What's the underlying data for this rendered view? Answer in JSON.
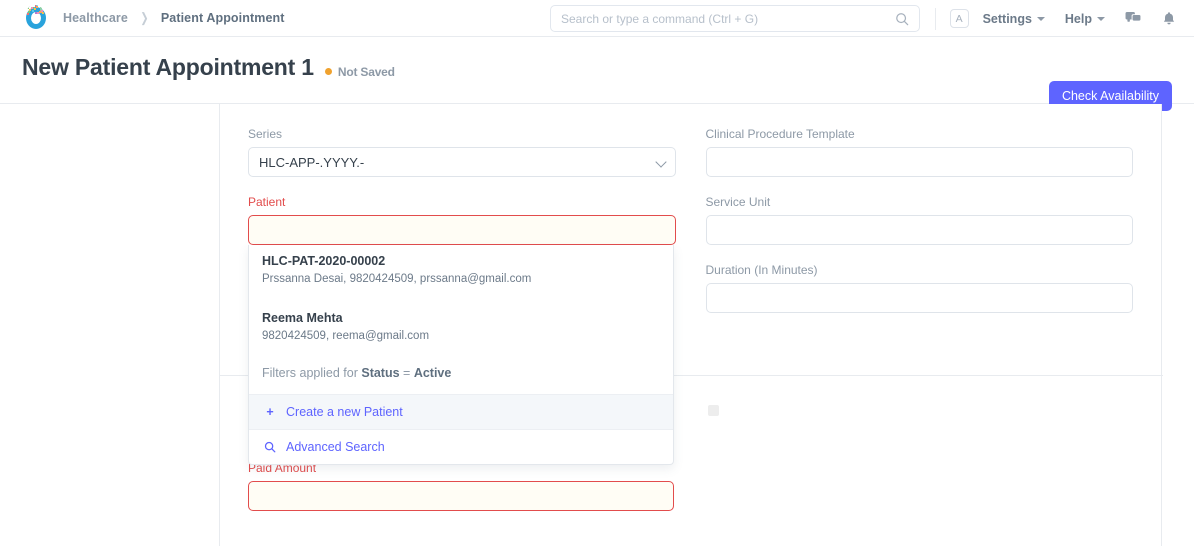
{
  "navbar": {
    "logo_icon": "frappe-ring-logo",
    "breadcrumbs": [
      {
        "label": "Healthcare"
      },
      {
        "label": "Patient Appointment"
      }
    ],
    "search": {
      "placeholder": "Search or type a command (Ctrl + G)",
      "value": "",
      "icon": "search-icon"
    },
    "avatar_initial": "A",
    "links": [
      {
        "label": "Settings"
      },
      {
        "label": "Help"
      }
    ],
    "icons": [
      {
        "name": "comments-icon"
      },
      {
        "name": "notifications-bell-icon"
      }
    ]
  },
  "page": {
    "title": "New Patient Appointment 1",
    "status": "Not Saved",
    "status_color": "#f0a22e",
    "primary_button": "Check Availability",
    "primary_button_color": "#5e64ff"
  },
  "form": {
    "fields": {
      "series": {
        "label": "Series",
        "value": "HLC-APP-.YYYY.-",
        "placeholder": ""
      },
      "patient": {
        "label": "Patient",
        "value": "",
        "placeholder": "",
        "required": true
      },
      "clinical_procedure_template": {
        "label": "Clinical Procedure Template",
        "value": "",
        "placeholder": ""
      },
      "service_unit": {
        "label": "Service Unit",
        "value": "",
        "placeholder": ""
      },
      "duration": {
        "label": "Duration (In Minutes)",
        "value": "",
        "placeholder": ""
      },
      "paid_amount": {
        "label": "Paid Amount",
        "value": "",
        "placeholder": "",
        "required": true
      }
    }
  },
  "patient_dropdown": {
    "options": [
      {
        "title": "HLC-PAT-2020-00002",
        "description": "Prssanna Desai, 9820424509, prssanna@gmail.com"
      },
      {
        "title": "Reema Mehta",
        "description": "9820424509, reema@gmail.com"
      }
    ],
    "filter_prefix": "Filters applied for ",
    "filter_field": "Status",
    "filter_equals": " = ",
    "filter_value": "Active",
    "create_new": {
      "label": "Create a new Patient",
      "icon": "plus-icon"
    },
    "advanced_search": {
      "label": "Advanced Search",
      "icon": "search-icon"
    }
  }
}
